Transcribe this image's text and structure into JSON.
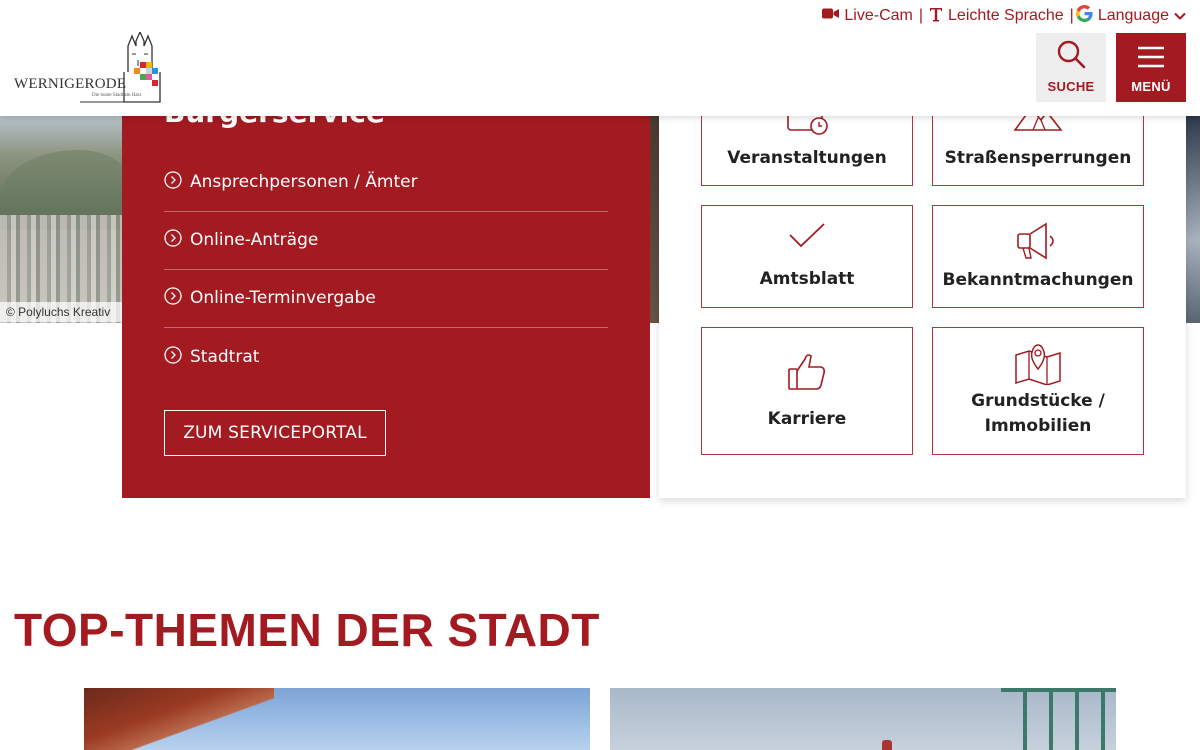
{
  "header": {
    "utility": {
      "livecam_label": "Live-Cam",
      "easy_language_label": "Leichte Sprache",
      "language_label": "Language",
      "separator": "|"
    },
    "logo": {
      "name": "WERNIGERODE",
      "tagline": "Die bunte Stadt am Harz"
    },
    "search_label": "SUCHE",
    "menu_label": "MENÜ"
  },
  "hero": {
    "credit": "© Polyluchs Kreativ"
  },
  "buergerservice": {
    "title": "Bürgerservice",
    "links": [
      {
        "label": "Ansprechpersonen / Ämter"
      },
      {
        "label": "Online-Anträge"
      },
      {
        "label": "Online-Terminvergabe"
      },
      {
        "label": "Stadtrat"
      }
    ],
    "portal_button": "ZUM SERVICEPORTAL"
  },
  "tiles": [
    {
      "label": "Veranstaltungen",
      "icon": "calendar-clock-icon"
    },
    {
      "label": "Straßensperrungen",
      "icon": "road-warning-icon"
    },
    {
      "label": "Amtsblatt",
      "icon": "checkmark-icon"
    },
    {
      "label": "Bekanntmachungen",
      "icon": "megaphone-icon"
    },
    {
      "label": "Karriere",
      "icon": "thumbs-up-icon"
    },
    {
      "label": "Grundstücke / Immobilien",
      "icon": "map-pin-icon"
    }
  ],
  "top_topics": {
    "title": "TOP-THEMEN DER STADT"
  },
  "colors": {
    "brand_red": "#a31a21",
    "tile_border": "#b5343b"
  }
}
